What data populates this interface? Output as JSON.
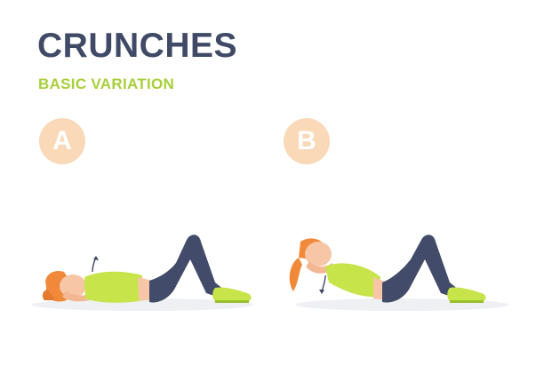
{
  "title": "CRUNCHES",
  "subtitle": "BASIC VARIATION",
  "steps": [
    {
      "label": "A"
    },
    {
      "label": "B"
    }
  ],
  "colors": {
    "title": "#404a66",
    "accent": "#a8cf3a",
    "badge": "#f9d9b7",
    "leggings": "#424c6a",
    "top": "#c7e44a",
    "skin": "#f6c6a6",
    "hair": "#f08a3a",
    "floor_shadow": "#eef0f3"
  },
  "icons": {
    "figure_a": "woman-lying-crunch-start",
    "figure_b": "woman-crunch-raised",
    "arrow_a": "up-arrow-icon",
    "arrow_b": "down-arrow-icon"
  }
}
